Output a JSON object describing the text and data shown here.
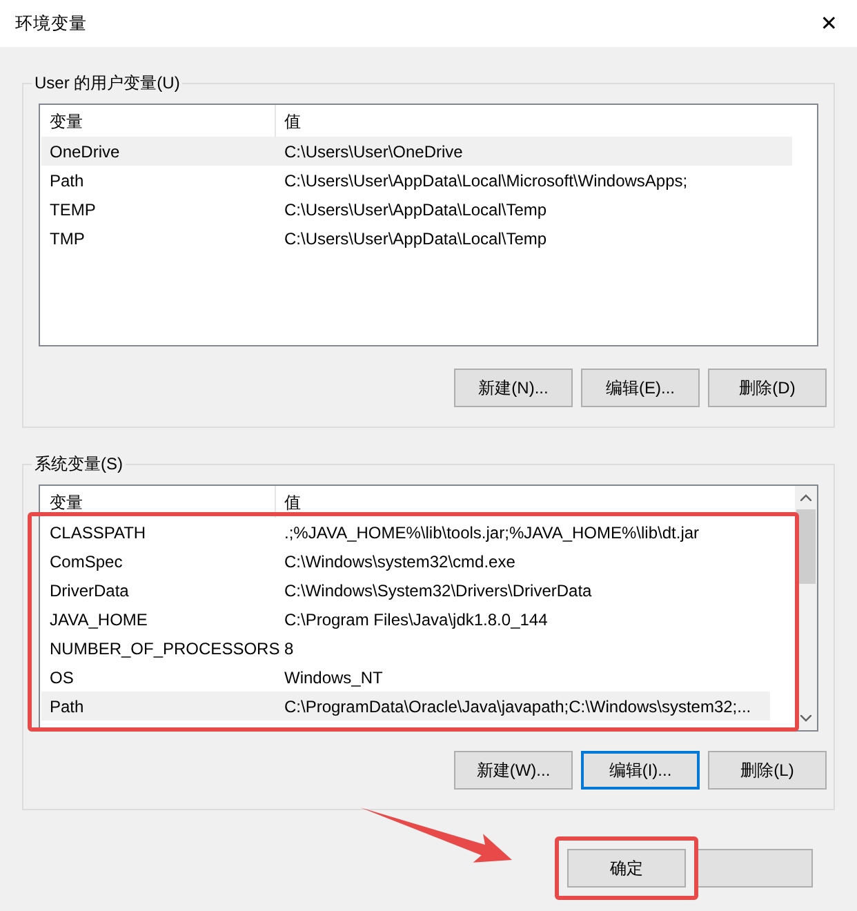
{
  "window": {
    "title": "环境变量",
    "close": "✕"
  },
  "user_variables": {
    "label": "User 的用户变量(U)",
    "columns": [
      "变量",
      "值"
    ],
    "rows": [
      {
        "name": "OneDrive",
        "value": "C:\\Users\\User\\OneDrive",
        "selected": true
      },
      {
        "name": "Path",
        "value": "C:\\Users\\User\\AppData\\Local\\Microsoft\\WindowsApps;",
        "selected": false
      },
      {
        "name": "TEMP",
        "value": "C:\\Users\\User\\AppData\\Local\\Temp",
        "selected": false
      },
      {
        "name": "TMP",
        "value": "C:\\Users\\User\\AppData\\Local\\Temp",
        "selected": false
      }
    ],
    "buttons": [
      {
        "label": "新建(N)...",
        "focused": false
      },
      {
        "label": "编辑(E)...",
        "focused": false
      },
      {
        "label": "删除(D)",
        "focused": false
      }
    ]
  },
  "system_variables": {
    "label": "系统变量(S)",
    "columns": [
      "变量",
      "值"
    ],
    "rows": [
      {
        "name": "CLASSPATH",
        "value": ".;%JAVA_HOME%\\lib\\tools.jar;%JAVA_HOME%\\lib\\dt.jar",
        "selected": false
      },
      {
        "name": "ComSpec",
        "value": "C:\\Windows\\system32\\cmd.exe",
        "selected": false
      },
      {
        "name": "DriverData",
        "value": "C:\\Windows\\System32\\Drivers\\DriverData",
        "selected": false
      },
      {
        "name": "JAVA_HOME",
        "value": "C:\\Program Files\\Java\\jdk1.8.0_144",
        "selected": false
      },
      {
        "name": "NUMBER_OF_PROCESSORS",
        "value": "8",
        "selected": false
      },
      {
        "name": "OS",
        "value": "Windows_NT",
        "selected": false
      },
      {
        "name": "Path",
        "value": "C:\\ProgramData\\Oracle\\Java\\javapath;C:\\Windows\\system32;...",
        "selected": true
      }
    ],
    "buttons": [
      {
        "label": "新建(W)...",
        "focused": false
      },
      {
        "label": "编辑(I)...",
        "focused": true
      },
      {
        "label": "删除(L)",
        "focused": false
      }
    ]
  },
  "dialog_buttons": [
    {
      "kind": "ok",
      "label": "确定",
      "focused": false
    },
    {
      "kind": "cancel",
      "focused": false
    }
  ],
  "annotations": [
    {
      "kind": "list-highlight"
    },
    {
      "kind": "arrow"
    },
    {
      "kind": "button-highlight"
    }
  ]
}
